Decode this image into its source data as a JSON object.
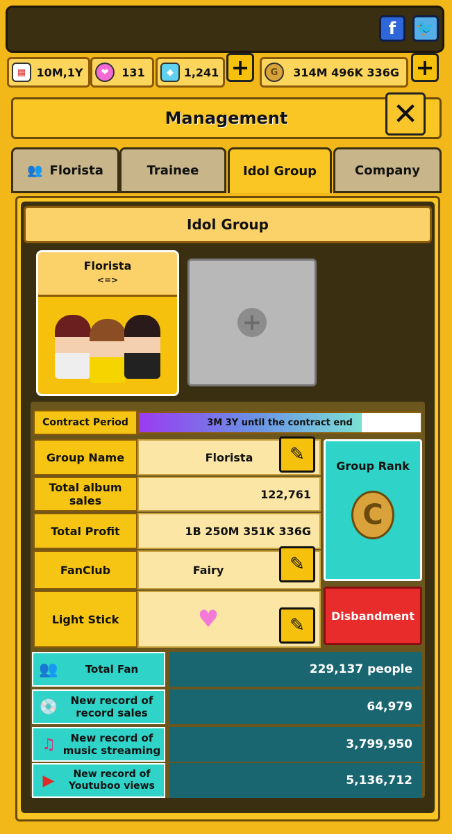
{
  "header": {
    "facebook_icon": "f",
    "twitter_icon": "bird"
  },
  "resources": {
    "date": "10M,1Y",
    "hearts": "131",
    "gems": "1,241",
    "gold": "314M 496K 336G"
  },
  "title": "Management",
  "tabs": [
    {
      "label": "Florista",
      "active": false
    },
    {
      "label": "Trainee",
      "active": false
    },
    {
      "label": "Idol Group",
      "active": true
    },
    {
      "label": "Company",
      "active": false
    }
  ],
  "section_title": "Idol Group",
  "group_card": {
    "name": "Florista",
    "arrows": "<=>"
  },
  "contract": {
    "label": "Contract Period",
    "text": "3M 3Y  until the contract end",
    "progress": 0.79
  },
  "details": {
    "group_name_label": "Group  Name",
    "group_name": "Florista",
    "album_sales_label": "Total album sales",
    "album_sales": "122,761",
    "profit_label": "Total Profit",
    "profit": "1B 250M 351K 336G",
    "fanclub_label": "FanClub",
    "fanclub": "Fairy",
    "lightstick_label": "Light Stick"
  },
  "rank": {
    "label": "Group Rank",
    "grade": "C"
  },
  "disband_label": "Disbandment",
  "stats": [
    {
      "label": "Total Fan",
      "value": "229,137 people"
    },
    {
      "label": "New record of record sales",
      "value": "64,979"
    },
    {
      "label": "New record of music streaming",
      "value": "3,799,950"
    },
    {
      "label": "New record of Youtuboo views",
      "value": "5,136,712"
    }
  ],
  "colors": {
    "accent": "#f9c623",
    "teal": "#2fd3c7",
    "danger": "#e82b2b"
  }
}
